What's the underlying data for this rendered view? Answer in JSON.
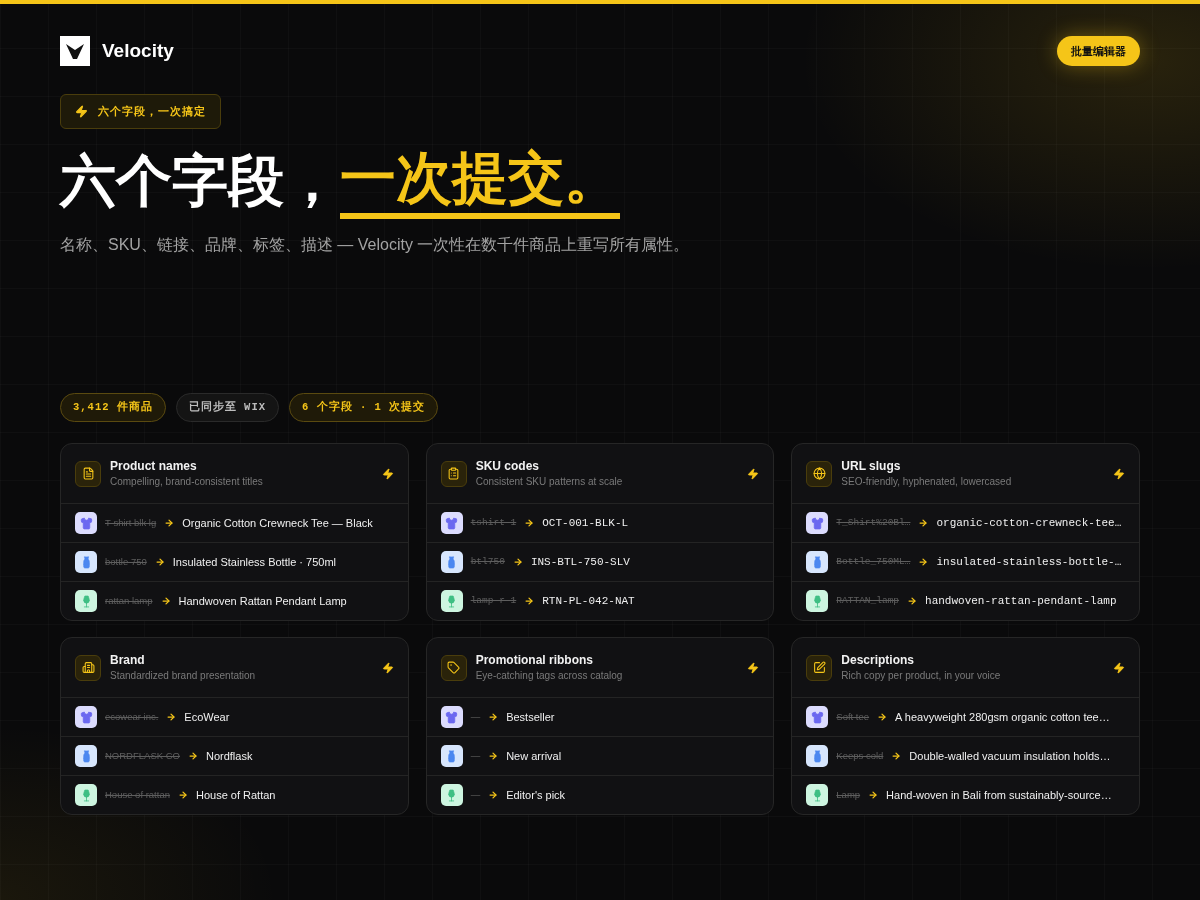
{
  "brand": {
    "name": "Velocity"
  },
  "header_button": "批量编辑器",
  "eyebrow": "六个字段，一次搞定",
  "headline": {
    "plain": "六个字段，",
    "highlight": "一次提交。"
  },
  "subtitle": "名称、SKU、链接、品牌、标签、描述 — Velocity 一次性在数千件商品上重写所有属性。",
  "stats": [
    {
      "label": "3,412 件商品",
      "kind": "accent"
    },
    {
      "label": "已同步至 WIX",
      "kind": "plain"
    },
    {
      "label": "6 个字段 · 1 次提交",
      "kind": "accent"
    }
  ],
  "cards": [
    {
      "title": "Product names",
      "subtitle": "Compelling, brand-consistent titles",
      "kind": "text",
      "rows": [
        {
          "kind": "tee",
          "before": "T-shirt blk lg",
          "struck": true,
          "after": "Organic Cotton Crewneck Tee — Black"
        },
        {
          "kind": "bottle",
          "before": "bottle 750",
          "struck": true,
          "after": "Insulated Stainless Bottle · 750ml"
        },
        {
          "kind": "lamp",
          "before": "rattan lamp",
          "struck": true,
          "after": "Handwoven Rattan Pendant Lamp"
        }
      ]
    },
    {
      "title": "SKU codes",
      "subtitle": "Consistent SKU patterns at scale",
      "kind": "code",
      "rows": [
        {
          "kind": "tee",
          "before": "tshirt-1",
          "struck": true,
          "after": "OCT-001-BLK-L"
        },
        {
          "kind": "bottle",
          "before": "btl750",
          "struck": true,
          "after": "INS-BTL-750-SLV"
        },
        {
          "kind": "lamp",
          "before": "lamp-r-1",
          "struck": true,
          "after": "RTN-PL-042-NAT"
        }
      ]
    },
    {
      "title": "URL slugs",
      "subtitle": "SEO-friendly, hyphenated, lowercased",
      "kind": "code",
      "rows": [
        {
          "kind": "tee",
          "before": "T_Shirt%20Bl…",
          "struck": true,
          "after": "organic-cotton-crewneck-tee…"
        },
        {
          "kind": "bottle",
          "before": "Bottle_750ML…",
          "struck": true,
          "after": "insulated-stainless-bottle-…"
        },
        {
          "kind": "lamp",
          "before": "RATTAN_lamp",
          "struck": true,
          "after": "handwoven-rattan-pendant-lamp"
        }
      ]
    },
    {
      "title": "Brand",
      "subtitle": "Standardized brand presentation",
      "kind": "text",
      "rows": [
        {
          "kind": "tee",
          "before": "ecowear inc.",
          "struck": true,
          "after": "EcoWear"
        },
        {
          "kind": "bottle",
          "before": "NORDFLASK CO",
          "struck": true,
          "after": "Nordflask"
        },
        {
          "kind": "lamp",
          "before": "House of rattan",
          "struck": true,
          "after": "House of Rattan"
        }
      ]
    },
    {
      "title": "Promotional ribbons",
      "subtitle": "Eye-catching tags across catalog",
      "kind": "text",
      "rows": [
        {
          "kind": "tee",
          "before": "—",
          "struck": false,
          "after": "Bestseller"
        },
        {
          "kind": "bottle",
          "before": "—",
          "struck": false,
          "after": "New arrival"
        },
        {
          "kind": "lamp",
          "before": "—",
          "struck": false,
          "after": "Editor's pick"
        }
      ]
    },
    {
      "title": "Descriptions",
      "subtitle": "Rich copy per product, in your voice",
      "kind": "text",
      "rows": [
        {
          "kind": "tee",
          "before": "Soft tee",
          "struck": true,
          "after": "A heavyweight 280gsm organic cotton tee…"
        },
        {
          "kind": "bottle",
          "before": "Keeps cold",
          "struck": true,
          "after": "Double-walled vacuum insulation holds…"
        },
        {
          "kind": "lamp",
          "before": "Lamp",
          "struck": true,
          "after": "Hand-woven in Bali from sustainably-source…"
        }
      ]
    }
  ]
}
